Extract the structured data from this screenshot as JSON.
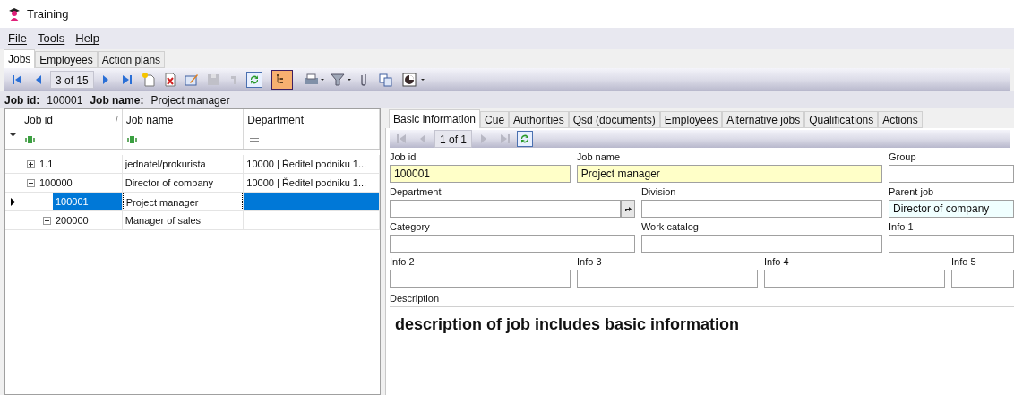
{
  "window": {
    "title": "Training"
  },
  "menu": [
    "File",
    "Tools",
    "Help"
  ],
  "tabs": [
    {
      "label": "Jobs",
      "selected": true
    },
    {
      "label": "Employees",
      "selected": false
    },
    {
      "label": "Action plans",
      "selected": false
    }
  ],
  "toolbar": {
    "position": "3 of 15",
    "tree_view_on": true
  },
  "info_bar": [
    {
      "label": "Job id:",
      "value": "100001"
    },
    {
      "label": "Job name:",
      "value": "Project manager"
    }
  ],
  "grid": {
    "columns": [
      {
        "label": "Job id",
        "sort": "/",
        "kind": "text"
      },
      {
        "label": "Job name",
        "kind": "text"
      },
      {
        "label": "Department",
        "kind": "equals"
      }
    ],
    "rows": [
      {
        "cells": [
          "1.1",
          "jednatel/prokurista",
          "10000 | Ředitel podniku 1..."
        ],
        "kind": "node",
        "expanded": false,
        "selected": false
      },
      {
        "cells": [
          "100000",
          "Director of company",
          "10000 | Ředitel podniku 1..."
        ],
        "kind": "node",
        "expanded": true,
        "selected": false,
        "children": [
          {
            "cells": [
              "100001",
              "Project manager",
              null
            ],
            "kind": "leaf",
            "selected": true
          },
          {
            "cells": [
              "200000",
              "Manager of sales",
              null
            ],
            "kind": "node",
            "expanded": false,
            "selected": false
          }
        ]
      }
    ]
  },
  "detail_tabs": [
    {
      "label": "Basic information",
      "selected": true
    },
    {
      "label": "Cue",
      "selected": false
    },
    {
      "label": "Authorities",
      "selected": false
    },
    {
      "label": "Qsd (documents)",
      "selected": false
    },
    {
      "label": "Employees",
      "selected": false
    },
    {
      "label": "Alternative jobs",
      "selected": false
    },
    {
      "label": "Qualifications",
      "selected": false
    },
    {
      "label": "Actions",
      "selected": false
    }
  ],
  "detail_toolbar": {
    "position": "1 of 1"
  },
  "form_rows": [
    [
      {
        "label": "Job id",
        "value": "100001",
        "kind": "required"
      },
      {
        "label": "Job name",
        "value": "Project manager",
        "kind": "required"
      },
      {
        "label": "Group",
        "kind": "plain"
      }
    ],
    [
      {
        "label": "Department",
        "kind": "lookup"
      },
      {
        "label": "Division",
        "kind": "plain"
      },
      {
        "label": "Parent job",
        "value": "Director of company",
        "kind": "readonly"
      }
    ],
    [
      {
        "label": "Category",
        "kind": "plain"
      },
      {
        "label": "Work catalog",
        "kind": "plain"
      },
      {
        "label": "Info 1",
        "kind": "plain"
      }
    ],
    [
      {
        "label": "Info 2",
        "kind": "plain"
      },
      {
        "label": "Info 3",
        "kind": "plain"
      },
      {
        "label": "Info 4",
        "kind": "plain"
      },
      {
        "label": "Info 5",
        "kind": "plain"
      }
    ]
  ],
  "description": {
    "label": "Description",
    "value": "description of job includes basic information"
  }
}
